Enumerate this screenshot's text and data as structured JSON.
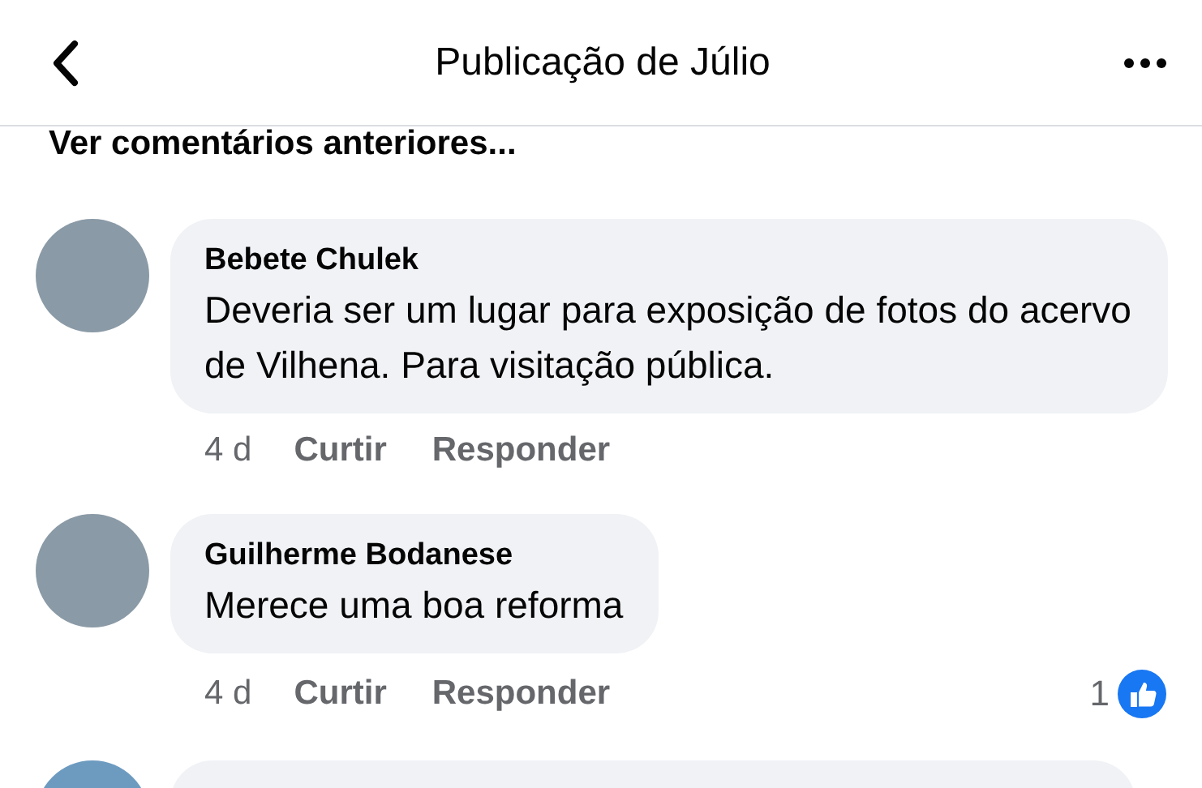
{
  "header": {
    "title": "Publicação de Júlio"
  },
  "previous_comments_link": "Ver comentários anteriores...",
  "comments": [
    {
      "author": "Bebete Chulek",
      "text": "Deveria ser um lugar para exposição de fotos do acervo de Vilhena. Para visitação pública.",
      "time": "4 d",
      "actions": [
        "Curtir",
        "Responder"
      ]
    },
    {
      "author": "Guilherme Bodanese",
      "text": "Merece uma boa reforma",
      "time": "4 d",
      "actions": [
        "Curtir",
        "Responder"
      ],
      "reaction_count": "1"
    }
  ]
}
